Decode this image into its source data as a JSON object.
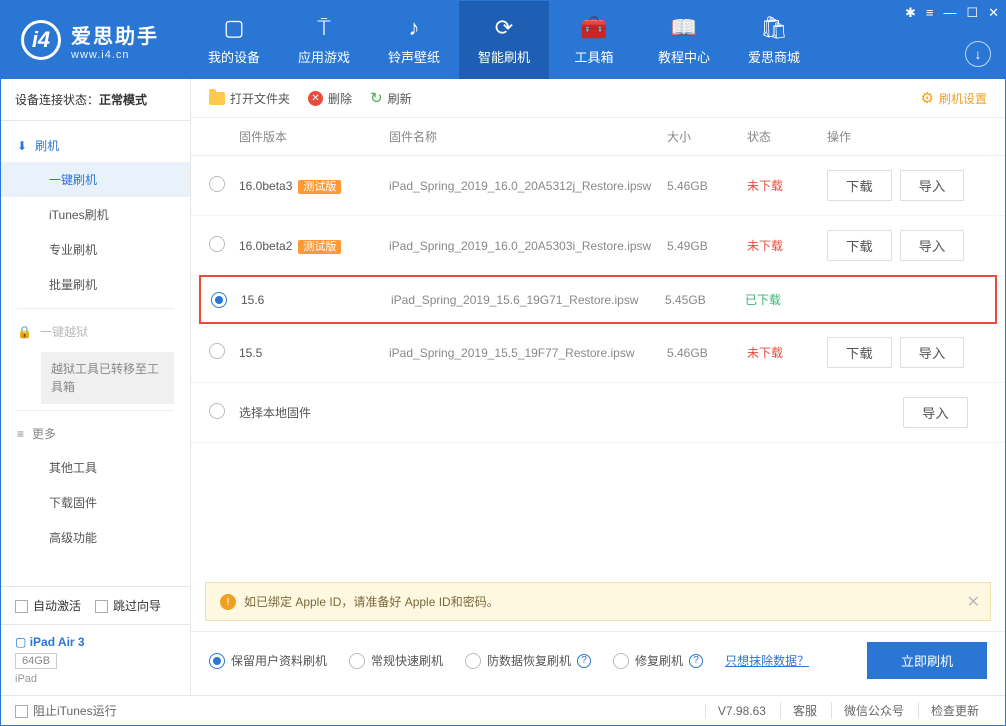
{
  "app": {
    "name": "爱思助手",
    "url": "www.i4.cn"
  },
  "nav": [
    {
      "label": "我的设备"
    },
    {
      "label": "应用游戏"
    },
    {
      "label": "铃声壁纸"
    },
    {
      "label": "智能刷机"
    },
    {
      "label": "工具箱"
    },
    {
      "label": "教程中心"
    },
    {
      "label": "爱思商城"
    }
  ],
  "sidebar": {
    "status_label": "设备连接状态：",
    "status_value": "正常模式",
    "groups": {
      "flash": {
        "head": "刷机",
        "items": [
          "一键刷机",
          "iTunes刷机",
          "专业刷机",
          "批量刷机"
        ]
      },
      "jb": {
        "head": "一键越狱",
        "note": "越狱工具已转移至工具箱"
      },
      "more": {
        "head": "更多",
        "items": [
          "其他工具",
          "下载固件",
          "高级功能"
        ]
      }
    },
    "bottom": {
      "auto": "自动激活",
      "skip": "跳过向导"
    },
    "device": {
      "name": "iPad Air 3",
      "cap": "64GB",
      "type": "iPad"
    }
  },
  "toolbar": {
    "open": "打开文件夹",
    "del": "删除",
    "refresh": "刷新",
    "settings": "刷机设置"
  },
  "table": {
    "headers": {
      "ver": "固件版本",
      "name": "固件名称",
      "size": "大小",
      "status": "状态",
      "ops": "操作"
    },
    "rows": [
      {
        "ver": "16.0beta3",
        "beta": "测试版",
        "name": "iPad_Spring_2019_16.0_20A5312j_Restore.ipsw",
        "size": "5.46GB",
        "status": "未下载",
        "downloaded": false,
        "selected": false
      },
      {
        "ver": "16.0beta2",
        "beta": "测试版",
        "name": "iPad_Spring_2019_16.0_20A5303i_Restore.ipsw",
        "size": "5.49GB",
        "status": "未下载",
        "downloaded": false,
        "selected": false
      },
      {
        "ver": "15.6",
        "beta": "",
        "name": "iPad_Spring_2019_15.6_19G71_Restore.ipsw",
        "size": "5.45GB",
        "status": "已下载",
        "downloaded": true,
        "selected": true
      },
      {
        "ver": "15.5",
        "beta": "",
        "name": "iPad_Spring_2019_15.5_19F77_Restore.ipsw",
        "size": "5.46GB",
        "status": "未下载",
        "downloaded": false,
        "selected": false
      }
    ],
    "local": "选择本地固件",
    "btn_dl": "下载",
    "btn_imp": "导入"
  },
  "notice": "如已绑定 Apple ID，请准备好 Apple ID和密码。",
  "options": {
    "items": [
      "保留用户资料刷机",
      "常规快速刷机",
      "防数据恢复刷机",
      "修复刷机"
    ],
    "link": "只想抹除数据？",
    "action": "立即刷机"
  },
  "status": {
    "block": "阻止iTunes运行",
    "ver": "V7.98.63",
    "cs": "客服",
    "wx": "微信公众号",
    "upd": "检查更新"
  }
}
